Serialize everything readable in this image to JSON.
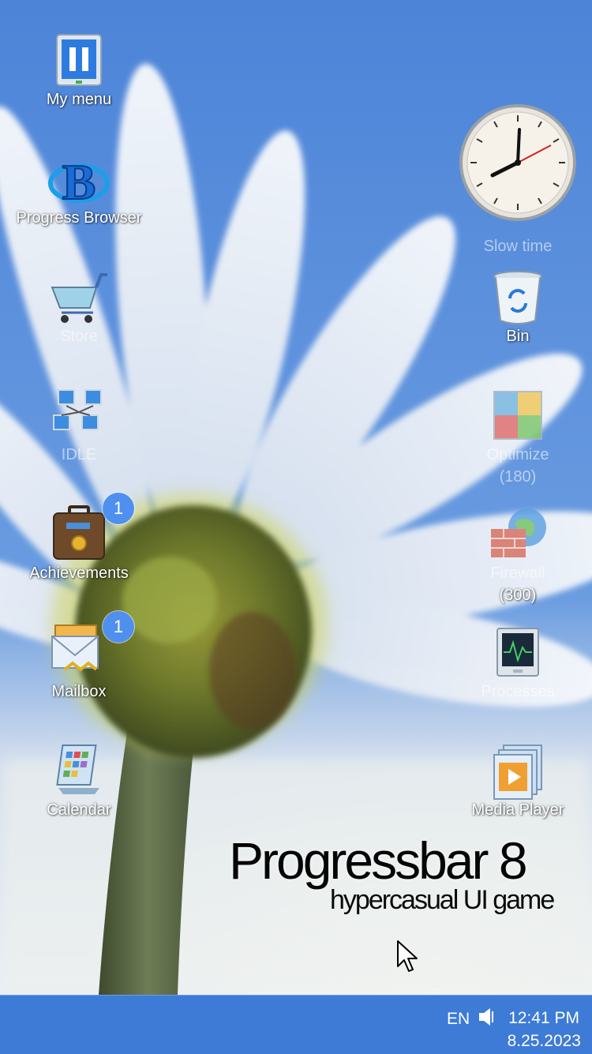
{
  "desktop": {
    "left_icons": [
      {
        "label": "My menu",
        "icon": "my-menu-icon"
      },
      {
        "label": "Progress Browser",
        "icon": "browser-icon"
      },
      {
        "label": "Store",
        "icon": "cart-icon"
      },
      {
        "label": "IDLE",
        "icon": "network-icon"
      },
      {
        "label": "Achievements",
        "icon": "briefcase-icon",
        "badge": "1"
      },
      {
        "label": "Mailbox",
        "icon": "mail-icon",
        "badge": "1"
      },
      {
        "label": "Calendar",
        "icon": "calendar-icon"
      }
    ],
    "right_icons": [
      {
        "label": "Slow time",
        "icon": "clock-icon",
        "dim": true
      },
      {
        "label": "Bin",
        "icon": "recycle-bin-icon"
      },
      {
        "label": "Optimize",
        "sublabel": "(180)",
        "icon": "blocks-icon",
        "dim": true
      },
      {
        "label": "Firewall",
        "sublabel": "(300)",
        "icon": "firewall-icon",
        "dim": true
      },
      {
        "label": "Processes",
        "icon": "monitor-icon",
        "dim": true
      },
      {
        "label": "Media Player",
        "icon": "media-player-icon"
      }
    ]
  },
  "branding": {
    "title": "Progressbar 8",
    "subtitle": "hypercasual UI game"
  },
  "taskbar": {
    "language": "EN",
    "volume_icon": "speaker-icon",
    "time": "12:41 PM",
    "date": "8.25.2023"
  },
  "colors": {
    "sky": "#4f86d9",
    "taskbar": "#3d7bd6",
    "badge": "#4f8ff0"
  }
}
